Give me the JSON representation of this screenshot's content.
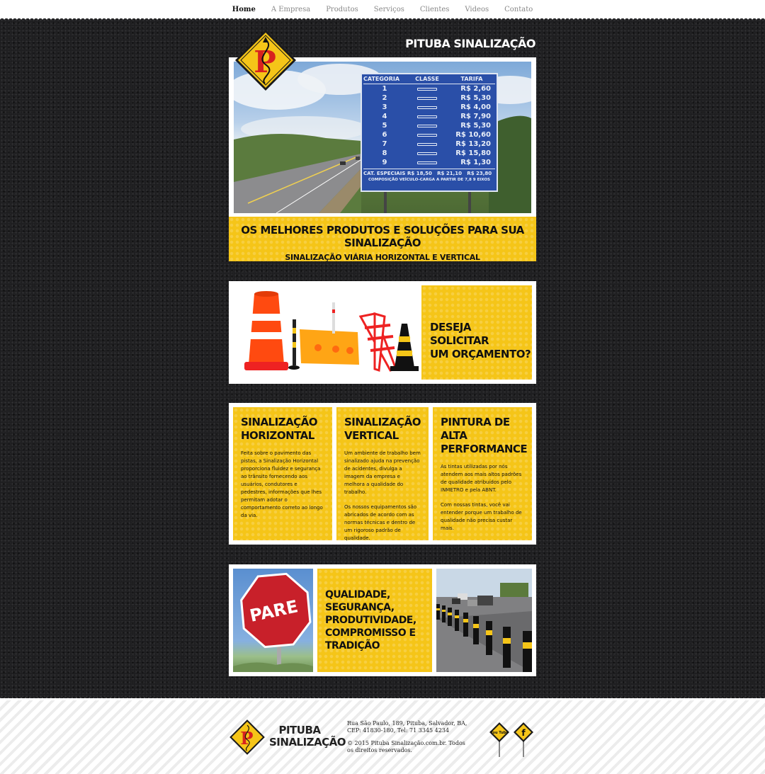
{
  "nav": {
    "items": [
      {
        "label": "Home",
        "active": true
      },
      {
        "label": "A Empresa"
      },
      {
        "label": "Produtos"
      },
      {
        "label": "Serviços"
      },
      {
        "label": "Clientes"
      },
      {
        "label": "Videos"
      },
      {
        "label": "Contato"
      }
    ]
  },
  "brand": {
    "title": "PITUBA SINALIZAÇÃO",
    "logo_letter": "P",
    "accent_yellow": "#f5c518"
  },
  "hero": {
    "toll_sign": {
      "headers": [
        "CATEGORIA",
        "CLASSE",
        "TARIFA"
      ],
      "rows": [
        {
          "cat": "1",
          "tarifa": "R$ 2,60"
        },
        {
          "cat": "2",
          "tarifa": "R$ 5,30"
        },
        {
          "cat": "3",
          "tarifa": "R$ 4,00"
        },
        {
          "cat": "4",
          "tarifa": "R$ 7,90"
        },
        {
          "cat": "5",
          "tarifa": "R$ 5,30"
        },
        {
          "cat": "6",
          "tarifa": "R$ 10,60"
        },
        {
          "cat": "7",
          "tarifa": "R$ 13,20"
        },
        {
          "cat": "8",
          "tarifa": "R$ 15,80"
        },
        {
          "cat": "9",
          "tarifa": "R$ 1,30"
        }
      ],
      "especiais_label": "CAT. ESPECIAIS",
      "especiais_values": "R$ 18,50   R$ 21,10   R$ 23,80",
      "footer_line": "COMPOSIÇÃO VEÍCULO-CARGA A PARTIR DE 7,8 9 EIXOS"
    },
    "headline": "OS MELHORES PRODUTOS E SOLUÇÕES PARA SUA SINALIZAÇÃO",
    "subheadline": "SINALIZAÇÃO VIÁRIA HORIZONTAL E VERTICAL"
  },
  "quote": {
    "cta": "DESEJA SOLICITAR\nUM ORÇAMENTO?"
  },
  "features": [
    {
      "title": "SINALIZAÇÃO\nHORIZONTAL",
      "text": "Feita sobre o pavimento das pistas, a Sinalização Horizontal proporciona fluidez e segurança ao trânsito fornecendo aos usuários, condutores e pedestres, informações que lhes permitam adotar o comportamento correto ao longo da via."
    },
    {
      "title": "SINALIZAÇÃO\nVERTICAL",
      "text": "Um ambiente de trabalho bem sinalizado ajuda na prevenção de acidentes, divulga a imagem da empresa e melhora a qualidade do trabalho.",
      "text2": "Os nossos equipamentos são abricados de acordo com as normas técnicas e dentro de um rigoroso padrão de qualidade."
    },
    {
      "title": "PINTURA DE ALTA\nPERFORMANCE",
      "text": "As tintas utilizadas por nós atendem aos mais altos padrões de qualidade atribuídos pelo INMETRO e pela ABNT.",
      "text2": "Com nossas tintas, você vai entender porque um trabalho de qualidade não precisa custar mais."
    }
  ],
  "quality": {
    "stop_sign": "PARE",
    "text": "QUALIDADE,\nSEGURANÇA,\nPRODUTIVIDADE,\nCOMPROMISSO E\nTRADIÇÃO"
  },
  "footer": {
    "brand_line1": "PITUBA",
    "brand_line2": "SINALIZAÇÃO",
    "address": "Rua São Paulo, 189, Pituba, Salvador, BA, CEP: 41830-180, Tel: 71 3345 4234",
    "copyright": "© 2015 Pituba Sinalização.com.br. Todos os direitos reservados.",
    "youtube_label": "You Tube",
    "facebook_label": "f"
  }
}
